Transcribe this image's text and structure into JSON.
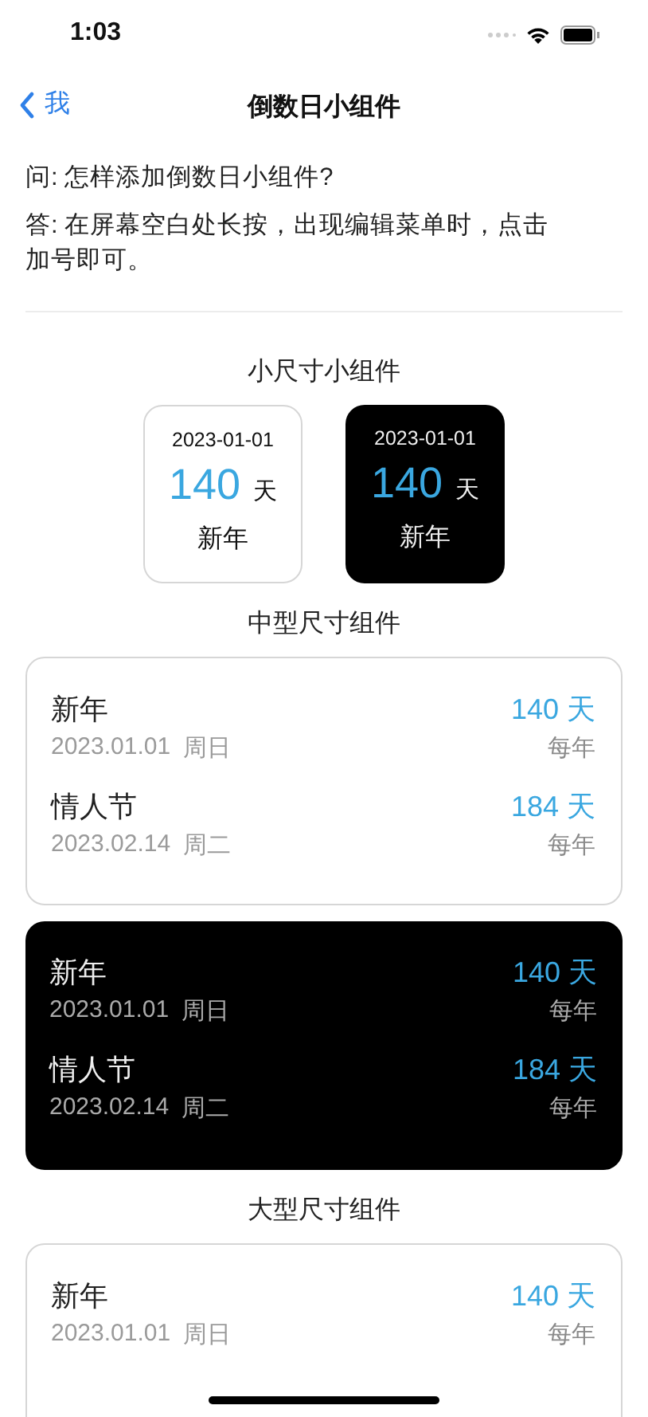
{
  "status_bar": {
    "time": "1:03"
  },
  "nav": {
    "back": "我",
    "title": "倒数日小组件"
  },
  "faq": {
    "question": "问: 怎样添加倒数日小组件?",
    "answer": "答: 在屏幕空白处长按，出现编辑菜单时，点击加号即可。"
  },
  "sections": [
    {
      "title": "小尺寸小组件",
      "kind": "small",
      "widgets": [
        {
          "kind": "light",
          "events": [
            {
              "date": "2023-01-01",
              "count": "140",
              "unit": "天",
              "name": "新年"
            }
          ]
        },
        {
          "kind": "dark",
          "events": [
            {
              "date": "2023-01-01",
              "count": "140",
              "unit": "天",
              "name": "新年"
            }
          ]
        }
      ]
    },
    {
      "title": "中型尺寸组件",
      "kind": "list",
      "widgets": [
        {
          "kind": "light",
          "events": [
            {
              "name": "新年",
              "date": "2023.01.01",
              "weekday": "周日",
              "count": "140 天",
              "repeat": "每年"
            },
            {
              "name": "情人节",
              "date": "2023.02.14",
              "weekday": "周二",
              "count": "184 天",
              "repeat": "每年"
            }
          ]
        },
        {
          "kind": "dark",
          "events": [
            {
              "name": "新年",
              "date": "2023.01.01",
              "weekday": "周日",
              "count": "140 天",
              "repeat": "每年"
            },
            {
              "name": "情人节",
              "date": "2023.02.14",
              "weekday": "周二",
              "count": "184 天",
              "repeat": "每年"
            }
          ]
        }
      ]
    },
    {
      "title": "大型尺寸组件",
      "kind": "list",
      "widgets": [
        {
          "kind": "light",
          "events": [
            {
              "name": "新年",
              "date": "2023.01.01",
              "weekday": "周日",
              "count": "140 天",
              "repeat": "每年"
            }
          ]
        }
      ]
    }
  ]
}
